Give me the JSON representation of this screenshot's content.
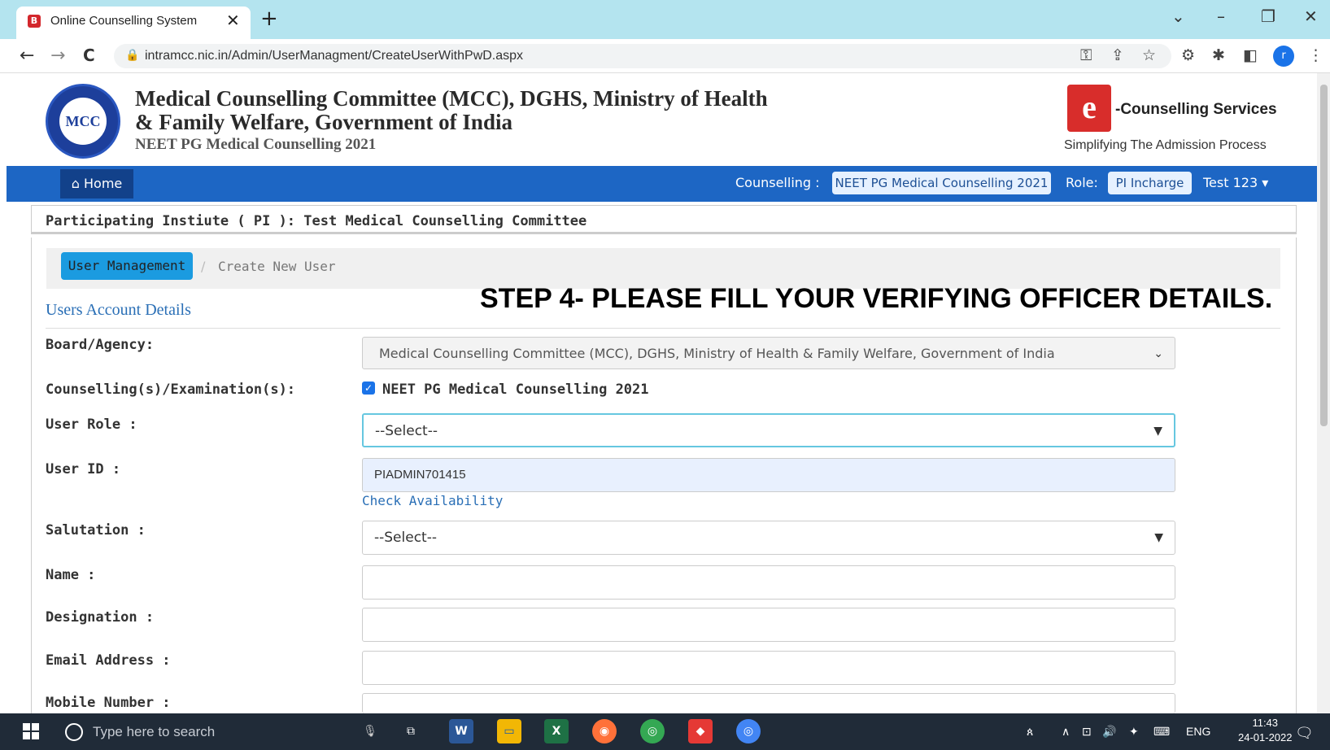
{
  "browser": {
    "tab_title": "Online Counselling System",
    "tab_close": "✕",
    "new_tab": "+",
    "url": "intramcc.nic.in/Admin/UserManagment/CreateUserWithPwD.aspx",
    "nav": {
      "back": "←",
      "forward": "→",
      "reload": "C"
    },
    "window_controls": {
      "chevron": "⌄",
      "minimize": "–",
      "restore": "❐",
      "close": "✕"
    },
    "profile_initial": "r"
  },
  "header": {
    "logo_text": "MCC",
    "title_line1": "Medical Counselling Committee (MCC), DGHS, Ministry of Health",
    "title_line2": "& Family Welfare, Government of India",
    "subtitle": "NEET PG Medical Counselling 2021",
    "e_logo": "e",
    "e_service": "-Counselling Services",
    "tagline": "Simplifying The Admission Process"
  },
  "navbar": {
    "home_label": "Home",
    "counselling_label": "Counselling :",
    "counselling_value": "NEET PG Medical Counselling 2021",
    "role_label": "Role:",
    "role_value": "PI Incharge",
    "user_menu": "Test 123 ▾"
  },
  "panel": {
    "pi_title": "Participating Instiute ( PI ): Test Medical Counselling Committee"
  },
  "breadcrumb": {
    "active": "User Management",
    "separator": "/",
    "current": "Create New User"
  },
  "form": {
    "section_title": "Users Account Details",
    "overlay_step": "STEP 4- PLEASE FILL YOUR VERIFYING OFFICER DETAILS.",
    "board_label": "Board/Agency:",
    "board_value": "Medical Counselling Committee (MCC), DGHS, Ministry of Health & Family Welfare, Government of India",
    "exam_label": "Counselling(s)/Examination(s):",
    "exam_option": "NEET PG Medical Counselling 2021",
    "exam_checked": true,
    "role_label": "User Role :",
    "role_value": "--Select--",
    "userid_label": "User ID :",
    "userid_value": "PIADMIN701415",
    "check_link": "Check Availability",
    "salutation_label": "Salutation :",
    "salutation_value": "--Select--",
    "name_label": "Name :",
    "name_value": "",
    "designation_label": "Designation :",
    "designation_value": "",
    "email_label": "Email Address :",
    "email_value": "",
    "mobile_label": "Mobile Number :"
  },
  "taskbar": {
    "search_placeholder": "Type here to search",
    "language": "ENG",
    "time": "11:43",
    "date": "24-01-2022"
  }
}
